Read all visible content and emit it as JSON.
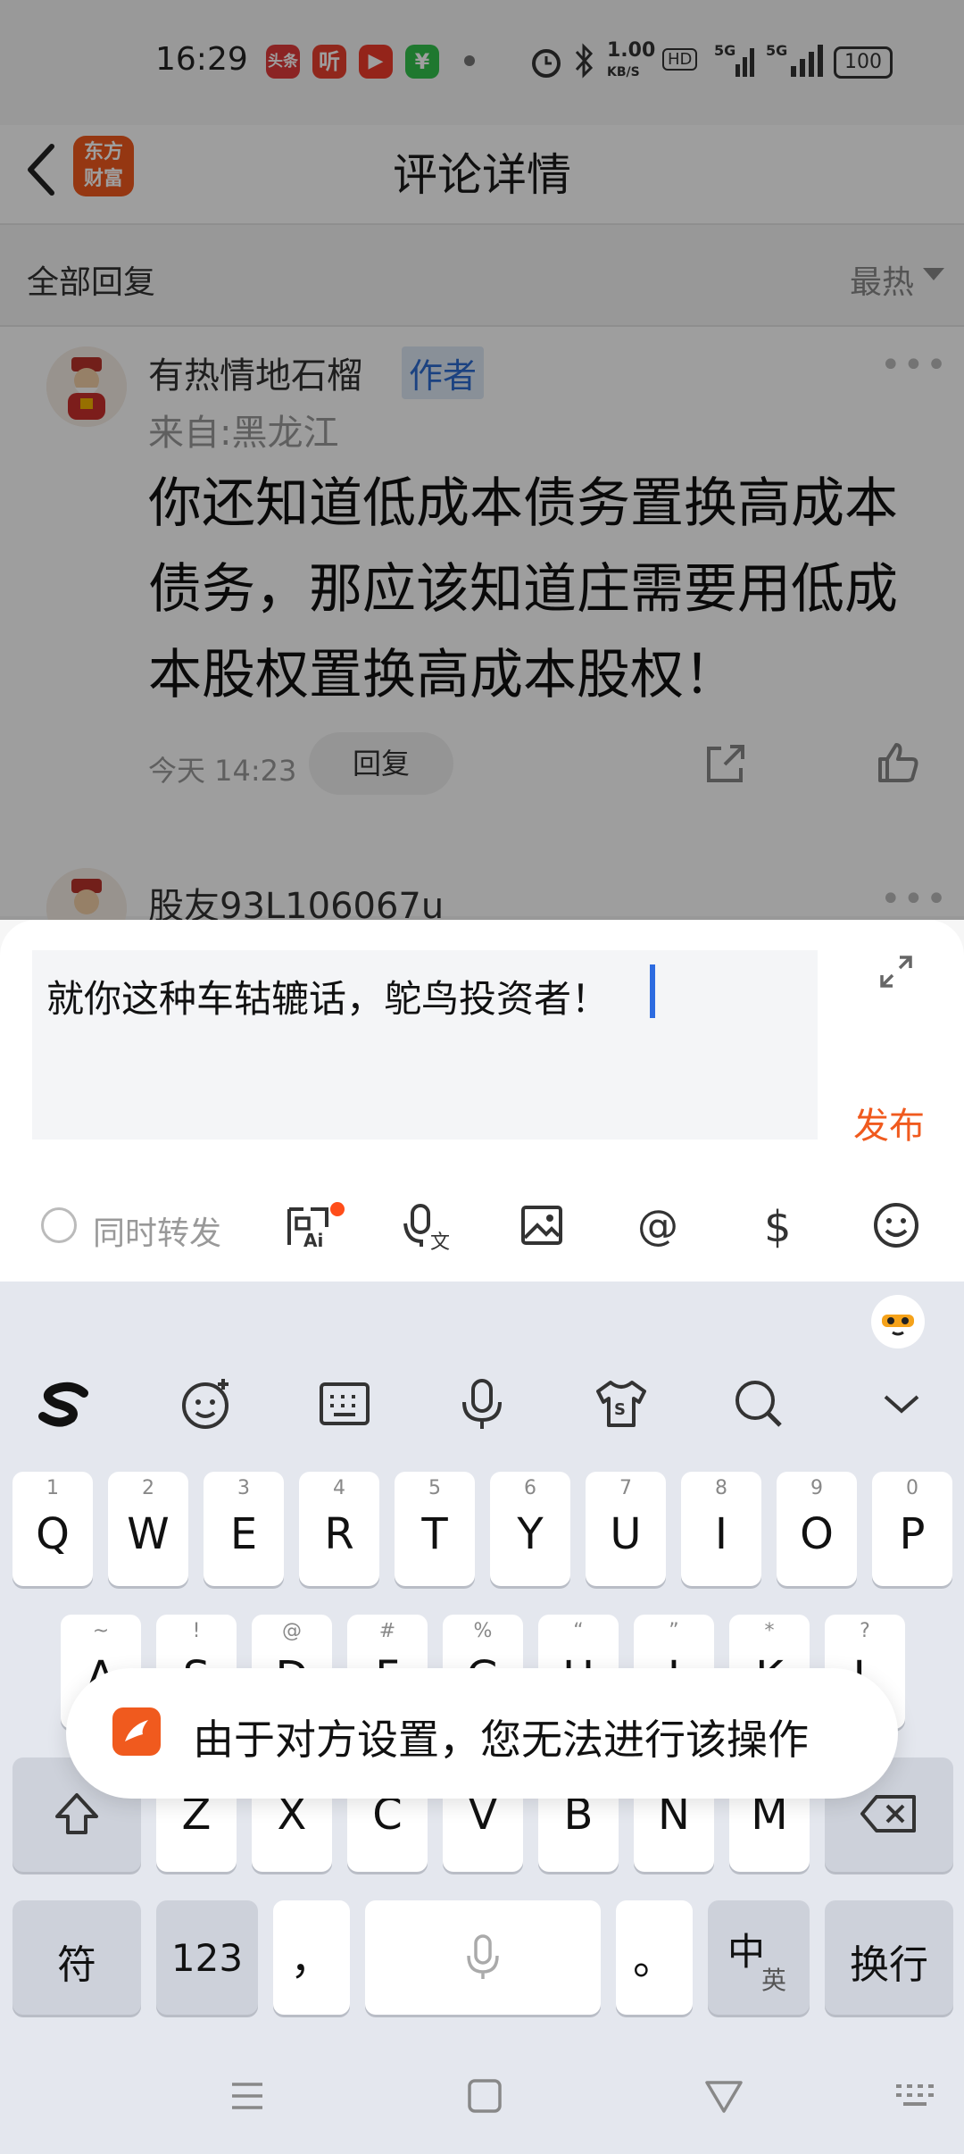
{
  "status_bar": {
    "time": "16:29",
    "apps": [
      {
        "label": "头条",
        "color": "#e03a3a"
      },
      {
        "label": "听",
        "color": "#e8402e"
      },
      {
        "label": "▶",
        "color": "#ef3b2b"
      },
      {
        "label": "¥",
        "color": "#32c24d"
      }
    ],
    "speed": "1.00",
    "speed_unit": "KB/S",
    "network": "5G",
    "battery": "100"
  },
  "header": {
    "back_icon": "chevron-left-icon",
    "logo_text_line1": "东方",
    "logo_text_line2": "财富",
    "title": "评论详情"
  },
  "subbar": {
    "all_replies": "全部回复",
    "sort": "最热"
  },
  "comments": [
    {
      "username": "有热情地石榴",
      "badge": "作者",
      "location": "来自:黑龙江",
      "text": "你还知道低成本债务置换高成本债务，那应该知道庄需要用低成本股权置换高成本股权！",
      "time": "今天 14:23",
      "reply_label": "回复"
    },
    {
      "username": "股友93L106067u"
    }
  ],
  "composer": {
    "input_value": "就你这种车轱辘话，鸵鸟投资者！",
    "publish_label": "发布",
    "repost_label": "同时转发",
    "tools": [
      "ai-question-icon",
      "voice-to-text-icon",
      "image-icon",
      "at-icon",
      "dollar-icon",
      "emoji-icon"
    ]
  },
  "keyboard": {
    "toolbar": [
      "sogou-logo-icon",
      "emoji-plus-icon",
      "keyboard-icon",
      "microphone-icon",
      "tshirt-skin-icon",
      "search-icon",
      "chevron-down-icon"
    ],
    "row1": [
      {
        "hint": "1",
        "key": "Q"
      },
      {
        "hint": "2",
        "key": "W"
      },
      {
        "hint": "3",
        "key": "E"
      },
      {
        "hint": "4",
        "key": "R"
      },
      {
        "hint": "5",
        "key": "T"
      },
      {
        "hint": "6",
        "key": "Y"
      },
      {
        "hint": "7",
        "key": "U"
      },
      {
        "hint": "8",
        "key": "I"
      },
      {
        "hint": "9",
        "key": "O"
      },
      {
        "hint": "0",
        "key": "P"
      }
    ],
    "row2": [
      {
        "hint": "~",
        "key": "A"
      },
      {
        "hint": "!",
        "key": "S"
      },
      {
        "hint": "@",
        "key": "D"
      },
      {
        "hint": "#",
        "key": "F"
      },
      {
        "hint": "%",
        "key": "G"
      },
      {
        "hint": "“",
        "key": "H"
      },
      {
        "hint": "”",
        "key": "J"
      },
      {
        "hint": "*",
        "key": "K"
      },
      {
        "hint": "?",
        "key": "L"
      }
    ],
    "row3": [
      "Z",
      "X",
      "C",
      "V",
      "B",
      "N",
      "M"
    ],
    "bottom": {
      "symbols": "符",
      "numbers": "123",
      "comma": "，",
      "period": "。",
      "lang_main": "中",
      "lang_sub": "英",
      "enter": "换行"
    }
  },
  "toast": {
    "message": "由于对方设置，您无法进行该操作"
  }
}
